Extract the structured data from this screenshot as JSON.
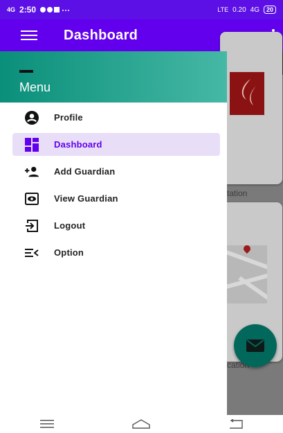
{
  "status_bar": {
    "network_label": "4G",
    "time": "2:50",
    "right_network": "LTE",
    "speed": "0.20",
    "signal_label": "4G",
    "battery": "20"
  },
  "app_bar": {
    "title": "Dashboard",
    "menu_icon": "hamburger-icon",
    "overflow_icon": "kebab-icon"
  },
  "drawer": {
    "title": "Menu",
    "items": [
      {
        "label": "Profile",
        "icon": "account-circle-icon",
        "active": false
      },
      {
        "label": "Dashboard",
        "icon": "dashboard-icon",
        "active": true
      },
      {
        "label": "Add Guardian",
        "icon": "person-add-icon",
        "active": false
      },
      {
        "label": "View Guardian",
        "icon": "view-icon",
        "active": false
      },
      {
        "label": "Logout",
        "icon": "logout-icon",
        "active": false
      },
      {
        "label": "Option",
        "icon": "option-icon",
        "active": false
      }
    ]
  },
  "background": {
    "card1_text": "tation",
    "card2_text": "cation",
    "fab_icon": "mail-icon"
  },
  "nav_bar": {
    "icons": [
      "menu-icon",
      "home-icon",
      "back-icon"
    ]
  },
  "colors": {
    "primary": "#6200ee",
    "status_bar": "#5c10e6",
    "drawer_header_start": "#0a8f7a",
    "drawer_header_end": "#46b8a5",
    "active_item_bg": "#e9def7",
    "fab": "#02685c"
  }
}
